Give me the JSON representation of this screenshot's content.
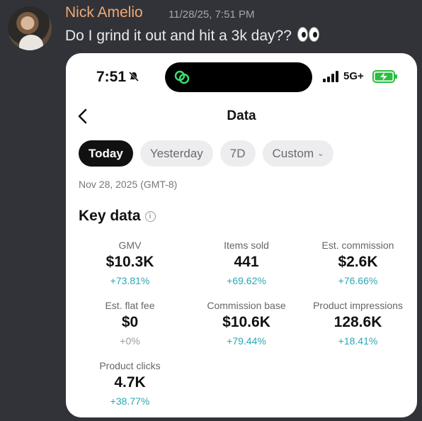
{
  "message": {
    "author": "Nick Amelio",
    "timestamp": "11/28/25, 7:51 PM",
    "text": "Do I grind it out and hit a 3k day??",
    "emoji": "eyes-emoji"
  },
  "phone": {
    "status": {
      "time": "7:51",
      "network": "5G+"
    },
    "header": {
      "title": "Data"
    },
    "filters": [
      {
        "label": "Today"
      },
      {
        "label": "Yesterday"
      },
      {
        "label": "7D"
      },
      {
        "label": "Custom"
      }
    ],
    "date": "Nov 28, 2025 (GMT-8)",
    "section_title": "Key data",
    "metrics": [
      {
        "label": "GMV",
        "value": "$10.3K",
        "delta": "+73.81%"
      },
      {
        "label": "Items sold",
        "value": "441",
        "delta": "+69.62%"
      },
      {
        "label": "Est. commission",
        "value": "$2.6K",
        "delta": "+76.66%"
      },
      {
        "label": "Est. flat fee",
        "value": "$0",
        "delta": "+0%"
      },
      {
        "label": "Commission base",
        "value": "$10.6K",
        "delta": "+79.44%"
      },
      {
        "label": "Product impressions",
        "value": "128.6K",
        "delta": "+18.41%"
      },
      {
        "label": "Product clicks",
        "value": "4.7K",
        "delta": "+38.77%"
      }
    ],
    "colors": {
      "accent_delta": "#2aa8b5",
      "author": "#f0a873",
      "active_chip": "#111111"
    }
  }
}
